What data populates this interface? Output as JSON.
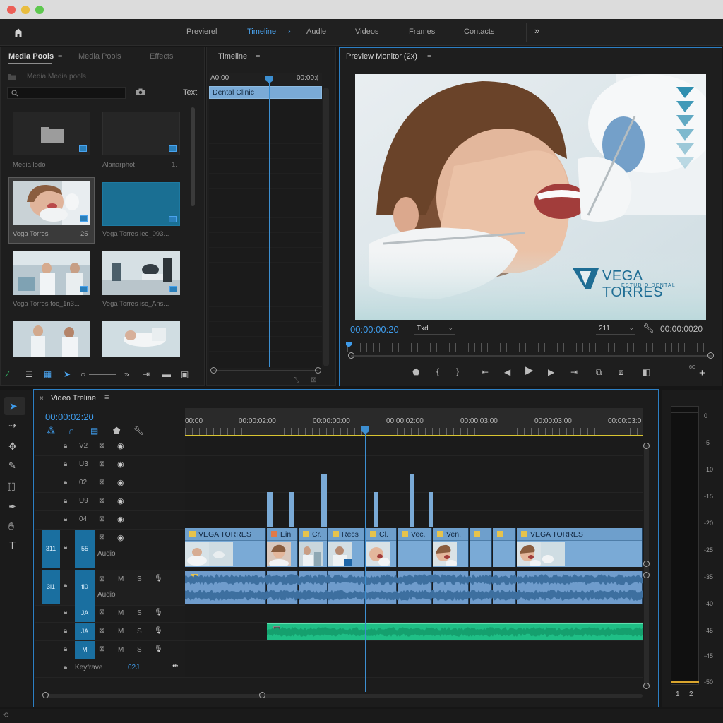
{
  "topnav": {
    "items": [
      "Previerel",
      "Timeline",
      "Audle",
      "Videos",
      "Frames",
      "Contacts"
    ],
    "active": "Timeline",
    "more": "»"
  },
  "media": {
    "tabs": [
      "Media Pools",
      "Media Pools",
      "Effects"
    ],
    "path": "Media Media pools",
    "text_label": "Text",
    "items": [
      {
        "label": "Media lodo"
      },
      {
        "label": "Alanarphot",
        "meta": "1."
      },
      {
        "label": "Vega Torres",
        "meta": "25"
      },
      {
        "label": "Vega Torres iec_093..."
      },
      {
        "label": "Vega Torres foc_1n3..."
      },
      {
        "label": "Vega Torres isc_Ans..."
      }
    ]
  },
  "timeline_panel": {
    "title": "Timeline",
    "time_left": "A0:00",
    "time_right": "00:00:(",
    "clip": "Dental Clinic"
  },
  "preview": {
    "title": "Preview Monitor (2x)",
    "timecode": "00:00:00:20",
    "fit": "Txd",
    "res": "211",
    "duration": "00:00:0020",
    "brand": "VEGA TORRES",
    "brand_sub": "ESTUDIO DENTAL",
    "corner": "6C"
  },
  "timeline": {
    "title": "Video Treline",
    "timecode": "00:00:02:20",
    "ruler": [
      "00:00",
      "00:00:02:00",
      "00:00:00:00",
      "00:00:02:00",
      "00:00:03:00",
      "00:00:03:00",
      "00:00:03:0"
    ],
    "video_tracks": [
      "V2",
      "U3",
      "02",
      "U9",
      "04"
    ],
    "v1": {
      "tag1": "311",
      "tag2": "55",
      "label": "Audio"
    },
    "a1": {
      "tag1": "3i1",
      "tag2": "fi0",
      "label": "Audio",
      "m": "M",
      "s": "S"
    },
    "audio_tracks": [
      "JA",
      "JA",
      "M"
    ],
    "keyframe": {
      "label": "Keyfrave",
      "value": "02J"
    },
    "clips": [
      "VEGA TORRES",
      "Ein",
      "Cr.",
      "Recs",
      "Cl.",
      "Vec.",
      "Ven.",
      "",
      "",
      "VEGA TORRES"
    ]
  },
  "meter": {
    "scale": [
      "0",
      "-5",
      "-10",
      "-15",
      "-20",
      "-25",
      "-35",
      "-40",
      "-45",
      "-45",
      "-50"
    ],
    "channels": [
      "1",
      "2"
    ]
  },
  "colors": {
    "accent": "#4aa3ee",
    "clip": "#7aaad6",
    "audio_green": "#1fbf86",
    "brand": "#2f8fb0"
  }
}
